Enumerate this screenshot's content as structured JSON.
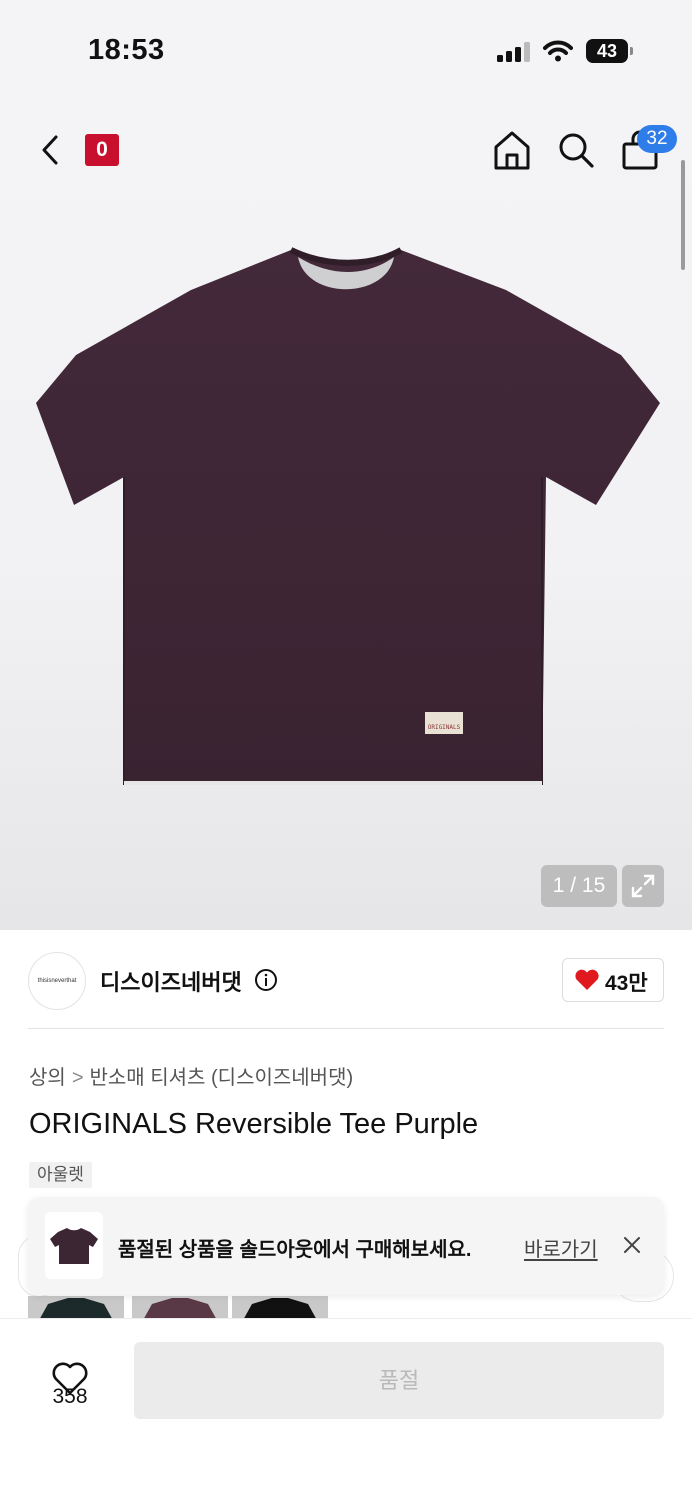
{
  "status_bar": {
    "time": "18:53",
    "battery": "43"
  },
  "nav": {
    "brand_logo": "0",
    "cart_count": "32"
  },
  "gallery": {
    "counter": "1 / 15",
    "product_label": "ORIGINALS"
  },
  "store": {
    "logo_text": "thisisneverthat",
    "name": "디스이즈네버댓",
    "likes": "43만"
  },
  "breadcrumb": {
    "level1": "상의",
    "separator": ">",
    "level2": "반소매 티셔츠 (디스이즈네버댓)"
  },
  "product": {
    "title": "ORIGINALS Reversible Tee Purple",
    "tag": "아울렛"
  },
  "toast": {
    "message": "품절된 상품을 솔드아웃에서 구매해보세요.",
    "link": "바로가기"
  },
  "bottom": {
    "wish_count": "358",
    "soldout_label": "품절"
  },
  "colors": {
    "accent_blue": "#2f7de9",
    "brand_red": "#c8102e",
    "heart_red": "#e0191f",
    "tee_purple": "#3d2634"
  },
  "icons": [
    "back-icon",
    "home-icon",
    "search-icon",
    "cart-icon",
    "expand-icon",
    "info-icon",
    "heart-icon",
    "close-icon"
  ]
}
